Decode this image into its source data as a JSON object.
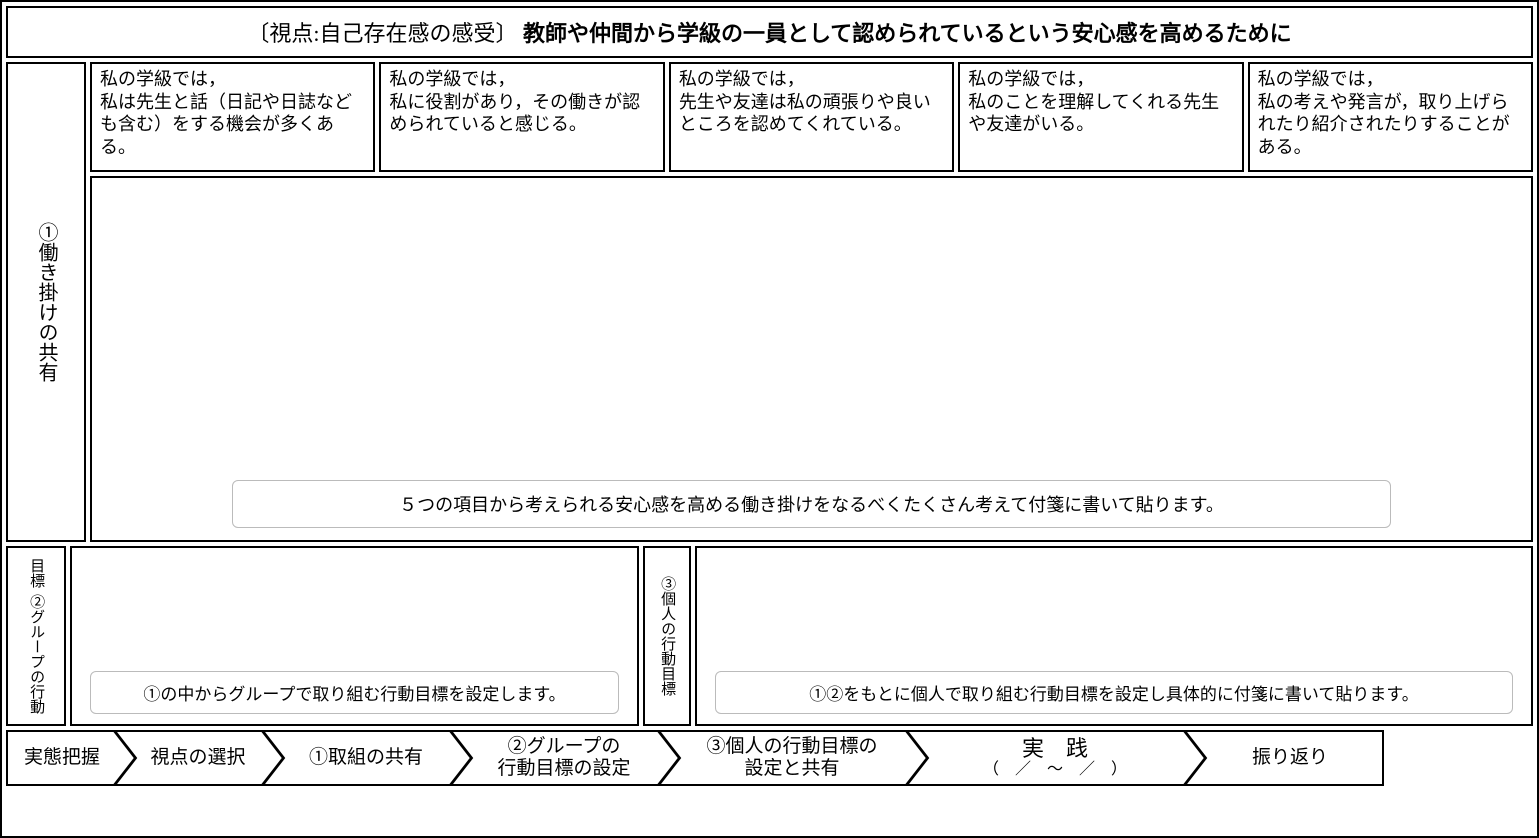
{
  "header": {
    "prefix": "〔視点:自己存在感の感受〕",
    "title": "教師や仲間から学級の一員として認められているという安心感を高めるために"
  },
  "section1": {
    "label": "①働き掛けの共有",
    "cards": [
      "私の学級では，\n私は先生と話（日記や日誌なども含む）をする機会が多くある。",
      "私の学級では，\n私に役割があり，その働きが認められていると感じる。",
      "私の学級では，\n先生や友達は私の頑張りや良いところを認めてくれている。",
      "私の学級では，\n私のことを理解してくれる先生や友達がいる。",
      "私の学級では，\n私の考えや発言が，取り上げられたり紹介されたりすることがある。"
    ],
    "hint": "５つの項目から考えられる安心感を高める働き掛けをなるべくたくさん考えて付箋に書いて貼ります。"
  },
  "section2": {
    "label_main": "②グループの行動",
    "label_sub": "目標",
    "hint": "①の中からグループで取り組む行動目標を設定します。"
  },
  "section3": {
    "label": "③個人の行動目標",
    "hint": "①②をもとに個人で取り組む行動目標を設定し具体的に付箋に書いて貼ります。"
  },
  "flow": {
    "steps": [
      {
        "line1": "実態把握"
      },
      {
        "line1": "視点の選択"
      },
      {
        "line1": "①取組の共有"
      },
      {
        "line1": "②グループの",
        "line2": "行動目標の設定"
      },
      {
        "line1": "③個人の行動目標の",
        "line2": "設定と共有"
      },
      {
        "line1": "実　践",
        "line2": "（　／　～　／　）"
      },
      {
        "line1": "振り返り"
      }
    ]
  }
}
